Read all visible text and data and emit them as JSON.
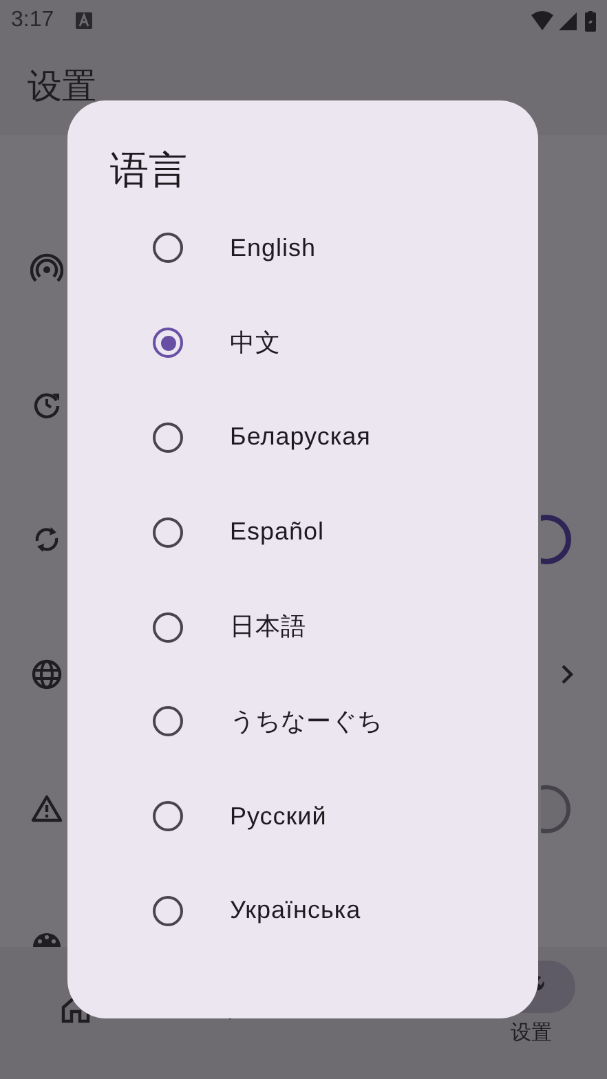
{
  "status_bar": {
    "time": "3:17"
  },
  "app_bar": {
    "title": "设置"
  },
  "dialog": {
    "title": "语言",
    "options": [
      {
        "label": "English",
        "selected": false
      },
      {
        "label": "中文",
        "selected": true
      },
      {
        "label": "Беларуская",
        "selected": false
      },
      {
        "label": "Español",
        "selected": false
      },
      {
        "label": "日本語",
        "selected": false
      },
      {
        "label": "うちなーぐち",
        "selected": false
      },
      {
        "label": "Русский",
        "selected": false
      },
      {
        "label": "Українська",
        "selected": false
      }
    ]
  },
  "bottom_nav": {
    "active_label": "设置"
  }
}
